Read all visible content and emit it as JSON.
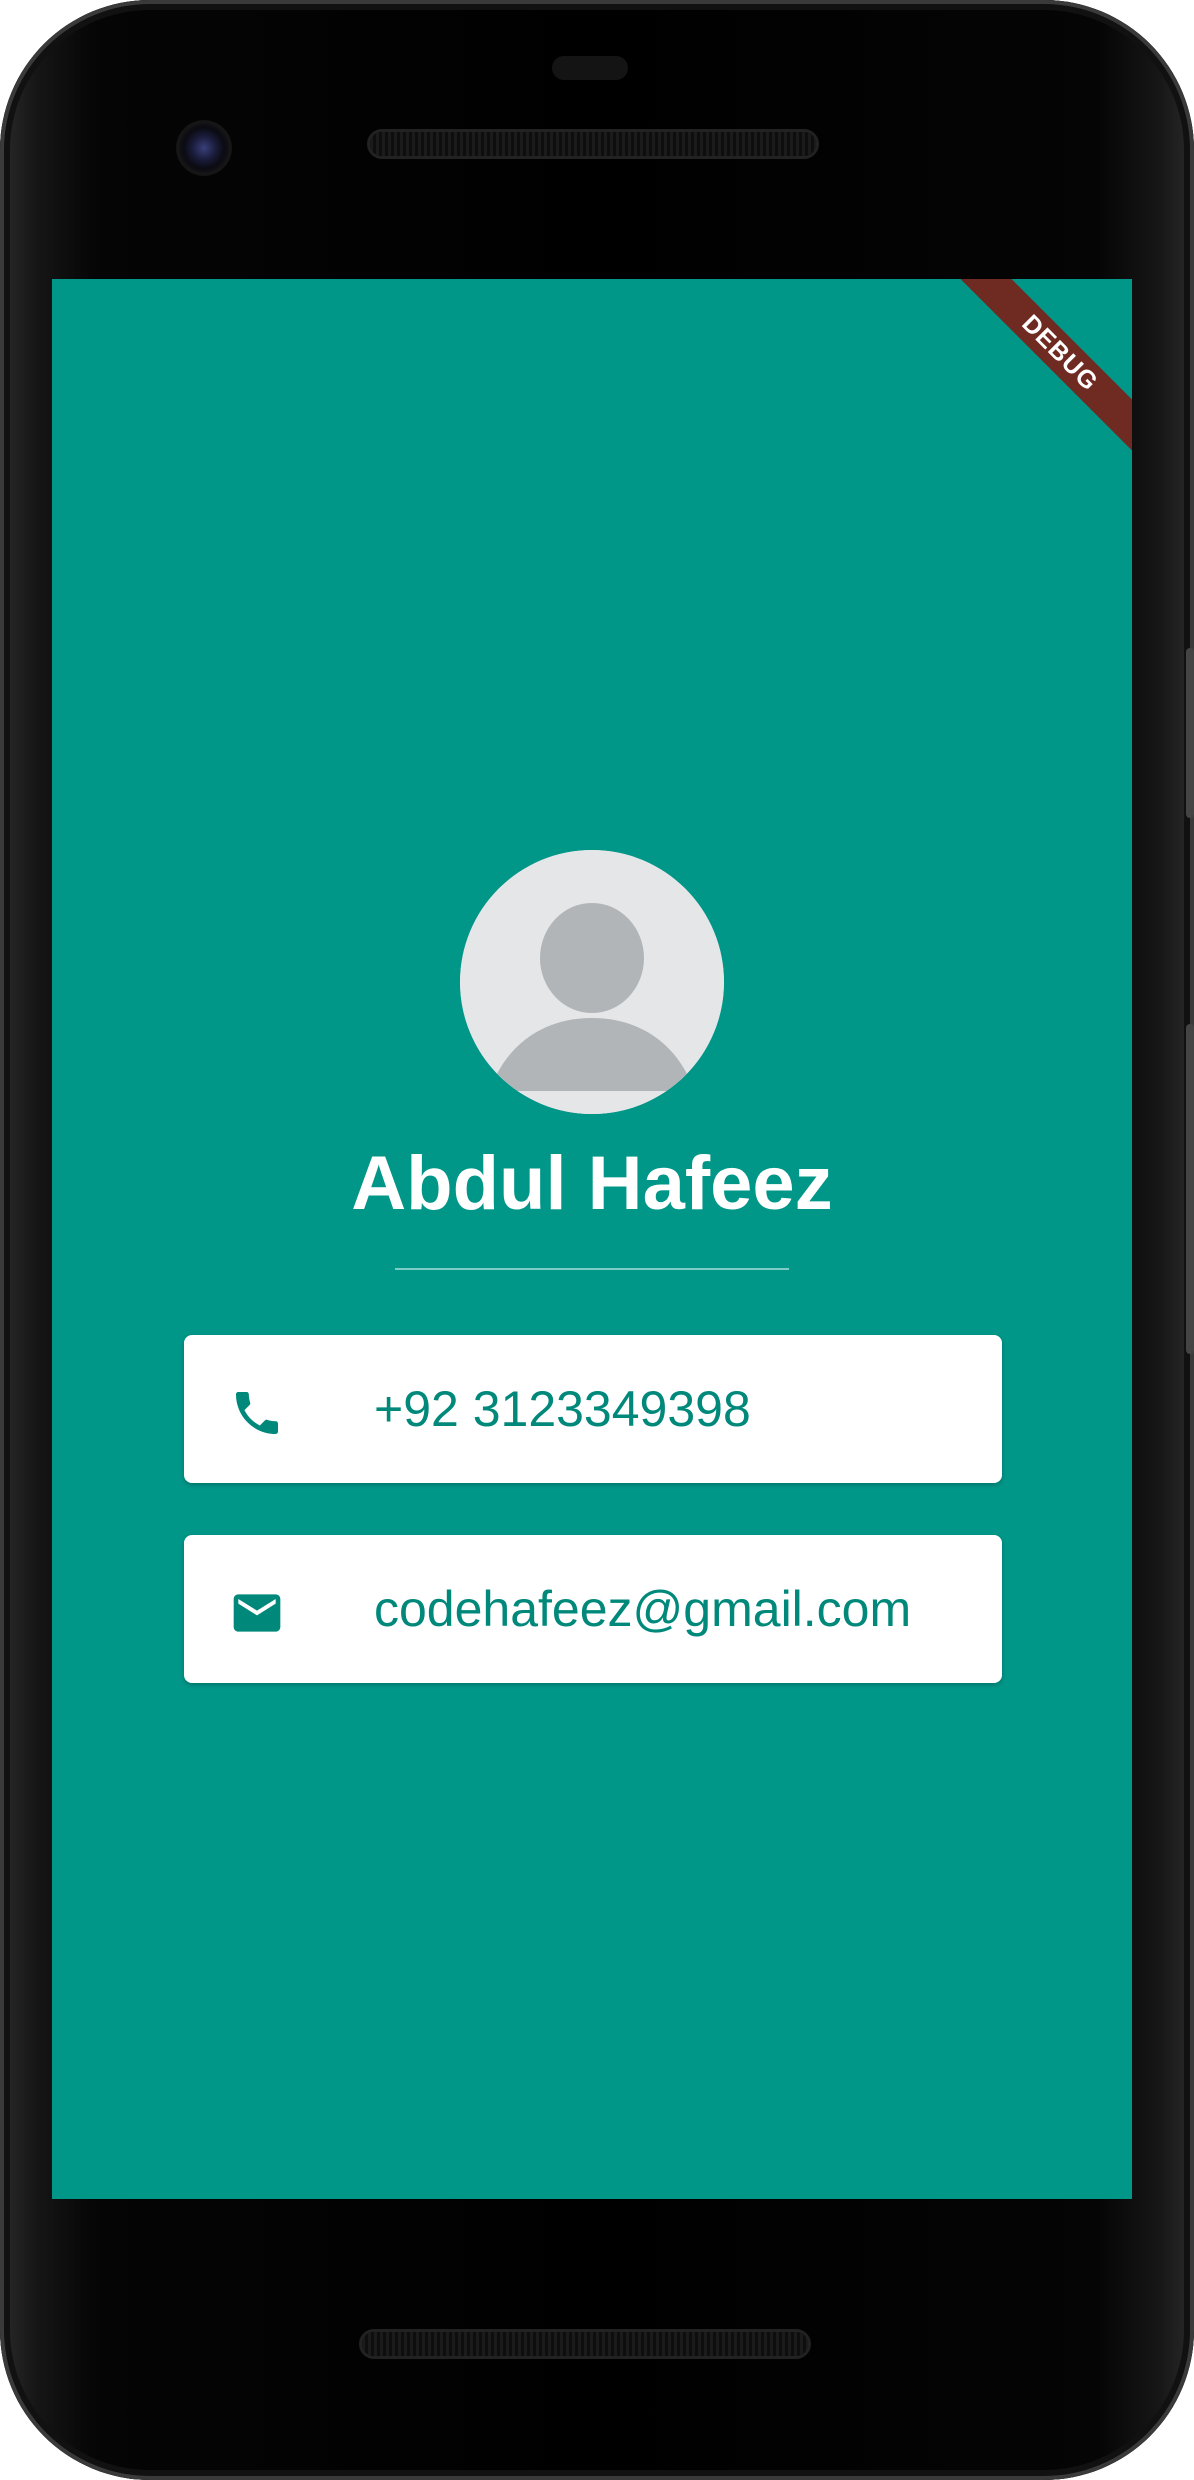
{
  "app": {
    "debug_banner": "DEBUG",
    "background_color": "#009688",
    "accent_color": "#00897B"
  },
  "profile": {
    "avatar_icon": "default-person-avatar",
    "name": "Abdul Hafeez"
  },
  "contact": {
    "phone": {
      "icon": "phone-icon",
      "value": "+92 3123349398"
    },
    "email": {
      "icon": "email-icon",
      "value": "codehafeez@gmail.com"
    }
  }
}
